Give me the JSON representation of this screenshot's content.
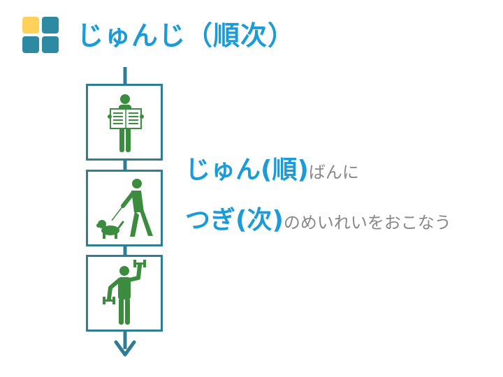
{
  "title": "じゅんじ（順次）",
  "lines": [
    {
      "emphasis": "じゅん(順)",
      "rest": "ばんに"
    },
    {
      "emphasis": "つぎ(次)",
      "rest": "のめいれいをおこなう"
    }
  ],
  "colors": {
    "title": "#1b9bd7",
    "accent_yellow": "#ffd05a",
    "accent_teal": "#2e8aa3",
    "flow_line": "#2f7d95",
    "figure_green": "#3b8c3f",
    "secondary_text": "#888888"
  },
  "steps": [
    {
      "icon": "person-reading-newspaper-icon"
    },
    {
      "icon": "person-walking-dog-icon"
    },
    {
      "icon": "person-lifting-dumbbells-icon"
    }
  ]
}
